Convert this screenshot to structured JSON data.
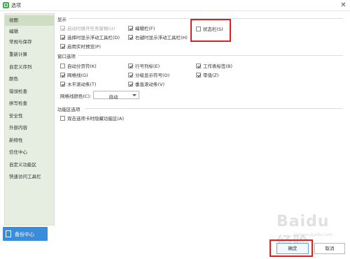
{
  "window": {
    "title": "选项",
    "close_glyph": "✕"
  },
  "sidebar": {
    "items": [
      {
        "label": "视图",
        "selected": true
      },
      {
        "label": "编辑"
      },
      {
        "label": "常规与保存"
      },
      {
        "label": "重新计算"
      },
      {
        "label": "自定义序列"
      },
      {
        "label": "颜色"
      },
      {
        "label": "错误检查"
      },
      {
        "label": "拼写检查"
      },
      {
        "label": "安全性"
      },
      {
        "label": "外部内容"
      },
      {
        "label": "新特性"
      },
      {
        "label": "信任中心"
      },
      {
        "label": "自定义功能区"
      },
      {
        "label": "快速访问工具栏"
      }
    ],
    "backup_label": "备份中心"
  },
  "display": {
    "title": "显示",
    "options": [
      {
        "label": "启动时展开任务窗格(U)",
        "checked": true,
        "disabled": true
      },
      {
        "label": "编辑栏(F)",
        "checked": true
      },
      {
        "label": "状态栏(S)",
        "checked": false
      },
      {
        "label": "选择时显示浮动工具栏(D)",
        "checked": true
      },
      {
        "label": "右键时显示浮动工具栏(H)",
        "checked": true
      },
      {
        "label": "启用实时预览(P)",
        "checked": true
      }
    ]
  },
  "window_options": {
    "title": "窗口选项",
    "options": [
      {
        "label": "自动分页符(K)",
        "checked": false
      },
      {
        "label": "行号列标(E)",
        "checked": true
      },
      {
        "label": "工作表标签(B)",
        "checked": true
      },
      {
        "label": "网格线(G)",
        "checked": true
      },
      {
        "label": "分级显示符号(O)",
        "checked": true
      },
      {
        "label": "零值(Z)",
        "checked": true
      },
      {
        "label": "水平滚动条(T)",
        "checked": true
      },
      {
        "label": "垂直滚动条(V)",
        "checked": true
      }
    ],
    "gridline_color_label": "网格线颜色(C):",
    "gridline_color_value": "自动"
  },
  "ribbon": {
    "title": "功能区选项",
    "options": [
      {
        "label": "双击选项卡时隐藏功能区(A)",
        "checked": false
      }
    ]
  },
  "footer": {
    "ok_label": "确定",
    "cancel_label": "取消"
  },
  "watermark": {
    "text": "Baidu 经验",
    "sub": "jingyan.baidu.com"
  },
  "colors": {
    "highlight": "#e02020",
    "accent": "#3a8ddb",
    "sidebar_bg": "#e5eee0"
  }
}
